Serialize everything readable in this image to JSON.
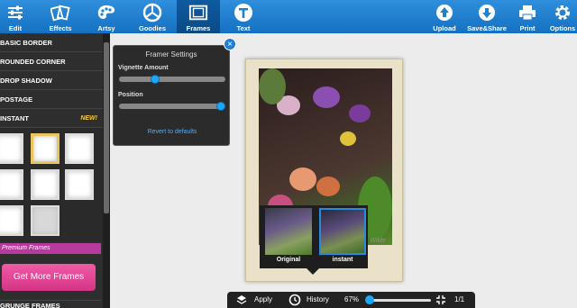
{
  "toolbar": {
    "left": [
      {
        "label": "Edit",
        "icon": "sliders-icon"
      },
      {
        "label": "Effects",
        "icon": "cards-icon"
      },
      {
        "label": "Artsy",
        "icon": "palette-icon"
      },
      {
        "label": "Goodies",
        "icon": "circle-icon"
      },
      {
        "label": "Frames",
        "icon": "frame-icon",
        "active": true
      },
      {
        "label": "Text",
        "icon": "text-t-icon"
      }
    ],
    "right": [
      {
        "label": "Upload",
        "icon": "upload-icon"
      },
      {
        "label": "Save&Share",
        "icon": "download-icon"
      },
      {
        "label": "Print",
        "icon": "print-icon"
      },
      {
        "label": "Options",
        "icon": "gear-icon"
      }
    ]
  },
  "sidebar": {
    "items": [
      "BASIC BORDER",
      "ROUNDED CORNER",
      "DROP SHADOW",
      "POSTAGE",
      "INSTANT"
    ],
    "new_badge": "New!",
    "premium_label": "Premium Frames",
    "get_more": "Get More Frames",
    "grunge": "GRUNGE FRAMES"
  },
  "framer": {
    "title": "Framer Settings",
    "vignette_label": "Vignette Amount",
    "vignette_value": 0.32,
    "position_label": "Position",
    "position_value": 1.0,
    "revert": "Revert to defaults",
    "close": "×"
  },
  "photo": {
    "watermark": "by Wilde"
  },
  "frame_options": [
    {
      "label": "Original"
    },
    {
      "label": "instant",
      "active": true
    }
  ],
  "bottombar": {
    "apply": "Apply",
    "history": "History",
    "zoom": "67%",
    "zoom_value": 0.67,
    "page": "1/1"
  },
  "colors": {
    "toolbar": "#1f80d0",
    "accent": "#1ea7ff",
    "premium": "#b73b9e",
    "get_more": "#e44894"
  }
}
